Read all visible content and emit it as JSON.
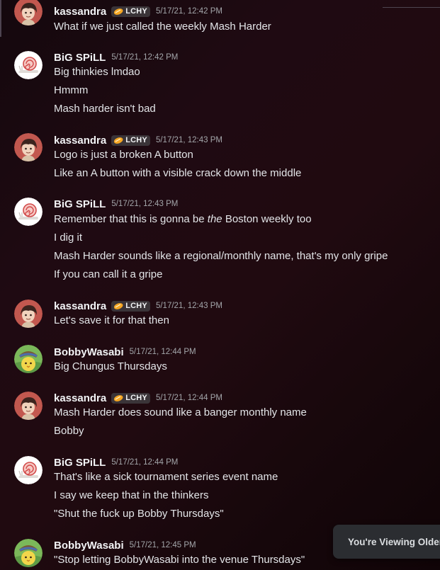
{
  "colors": {
    "username": "#f2f3f5",
    "message_text": "#e3e5e8",
    "timestamp": "#a3a6aa",
    "tag_bg": "#3a3438",
    "background": "#1f0a12"
  },
  "toast": {
    "text": "You're Viewing Older M"
  },
  "messages": [
    {
      "author": "kassandra",
      "avatar": "kassandra-avatar",
      "tag": "LCHY",
      "timestamp": "5/17/21, 12:42 PM",
      "lines": [
        "What if we just called the weekly Mash Harder"
      ]
    },
    {
      "author": "BiG SPiLL",
      "avatar": "snail-avatar",
      "timestamp": "5/17/21, 12:42 PM",
      "lines": [
        "Big thinkies lmdao",
        "Hmmm",
        "Mash harder isn't bad"
      ]
    },
    {
      "author": "kassandra",
      "avatar": "kassandra-avatar",
      "tag": "LCHY",
      "timestamp": "5/17/21, 12:43 PM",
      "lines": [
        "Logo is just a broken A button",
        "Like an A button with a visible crack down the middle"
      ]
    },
    {
      "author": "BiG SPiLL",
      "avatar": "snail-avatar",
      "timestamp": "5/17/21, 12:43 PM",
      "lines": [
        "Remember that this is gonna be",
        "the",
        "Boston weekly too",
        "I dig it",
        "Mash Harder sounds like a regional/monthly name, that's my only gripe",
        "If you can call it a gripe"
      ]
    },
    {
      "author": "kassandra",
      "avatar": "kassandra-avatar",
      "tag": "LCHY",
      "timestamp": "5/17/21, 12:43 PM",
      "lines": [
        "Let's save it for that then"
      ]
    },
    {
      "author": "BobbyWasabi",
      "avatar": "bobby-avatar",
      "timestamp": "5/17/21, 12:44 PM",
      "lines": [
        "Big Chungus Thursdays"
      ]
    },
    {
      "author": "kassandra",
      "avatar": "kassandra-avatar",
      "tag": "LCHY",
      "timestamp": "5/17/21, 12:44 PM",
      "lines": [
        "Mash Harder does sound like a banger monthly name",
        "Bobby"
      ]
    },
    {
      "author": "BiG SPiLL",
      "avatar": "snail-avatar",
      "timestamp": "5/17/21, 12:44 PM",
      "lines": [
        "That's like a sick tournament series event name",
        "I say we keep that in the thinkers",
        "\"Shut the fuck up Bobby Thursdays\""
      ]
    },
    {
      "author": "BobbyWasabi",
      "avatar": "bobby-avatar",
      "timestamp": "5/17/21, 12:45 PM",
      "lines": [
        "\"Stop letting BobbyWasabi into the venue Thursdays\""
      ]
    }
  ]
}
